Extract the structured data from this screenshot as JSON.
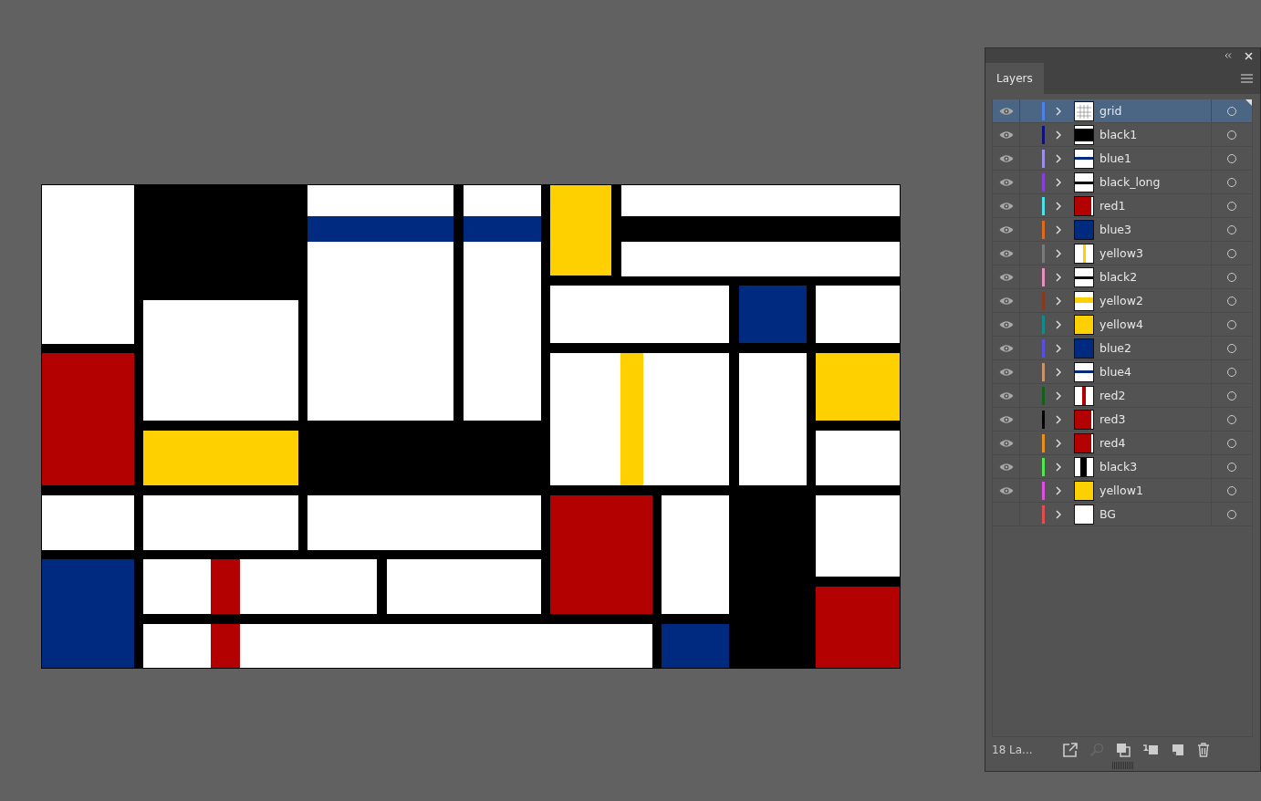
{
  "panel": {
    "tab": "Layers",
    "footer_count": "18 La..."
  },
  "layers": [
    {
      "name": "grid",
      "color": "#4f7fe8",
      "visible": true,
      "selected": true,
      "kind": "grid"
    },
    {
      "name": "black1",
      "color": "#10107a",
      "visible": true,
      "selected": false,
      "kind": "black-block"
    },
    {
      "name": "blue1",
      "color": "#9c8fe6",
      "visible": true,
      "selected": false,
      "kind": "blue-band"
    },
    {
      "name": "black_long",
      "color": "#8a3fdc",
      "visible": true,
      "selected": false,
      "kind": "black-band"
    },
    {
      "name": "red1",
      "color": "#4fe0e8",
      "visible": true,
      "selected": false,
      "kind": "red-block"
    },
    {
      "name": "blue3",
      "color": "#e06a1c",
      "visible": true,
      "selected": false,
      "kind": "blue-block"
    },
    {
      "name": "yellow3",
      "color": "#7a7a7a",
      "visible": true,
      "selected": false,
      "kind": "yellow-stripe"
    },
    {
      "name": "black2",
      "color": "#e88fc0",
      "visible": true,
      "selected": false,
      "kind": "black-band"
    },
    {
      "name": "yellow2",
      "color": "#8a3a1c",
      "visible": true,
      "selected": false,
      "kind": "yellow-band"
    },
    {
      "name": "yellow4",
      "color": "#14888a",
      "visible": true,
      "selected": false,
      "kind": "yellow-block"
    },
    {
      "name": "blue2",
      "color": "#5a4fe0",
      "visible": true,
      "selected": false,
      "kind": "blue-block"
    },
    {
      "name": "blue4",
      "color": "#c8956a",
      "visible": true,
      "selected": false,
      "kind": "blue-band"
    },
    {
      "name": "red2",
      "color": "#12601a",
      "visible": true,
      "selected": false,
      "kind": "red-stripe"
    },
    {
      "name": "red3",
      "color": "#000000",
      "visible": true,
      "selected": false,
      "kind": "red-block"
    },
    {
      "name": "red4",
      "color": "#e8901a",
      "visible": true,
      "selected": false,
      "kind": "red-block"
    },
    {
      "name": "black3",
      "color": "#4fe84f",
      "visible": true,
      "selected": false,
      "kind": "black-stripe"
    },
    {
      "name": "yellow1",
      "color": "#e04fe0",
      "visible": true,
      "selected": false,
      "kind": "yellow-block"
    },
    {
      "name": "BG",
      "color": "#e04f4f",
      "visible": false,
      "selected": false,
      "kind": "white"
    }
  ]
}
